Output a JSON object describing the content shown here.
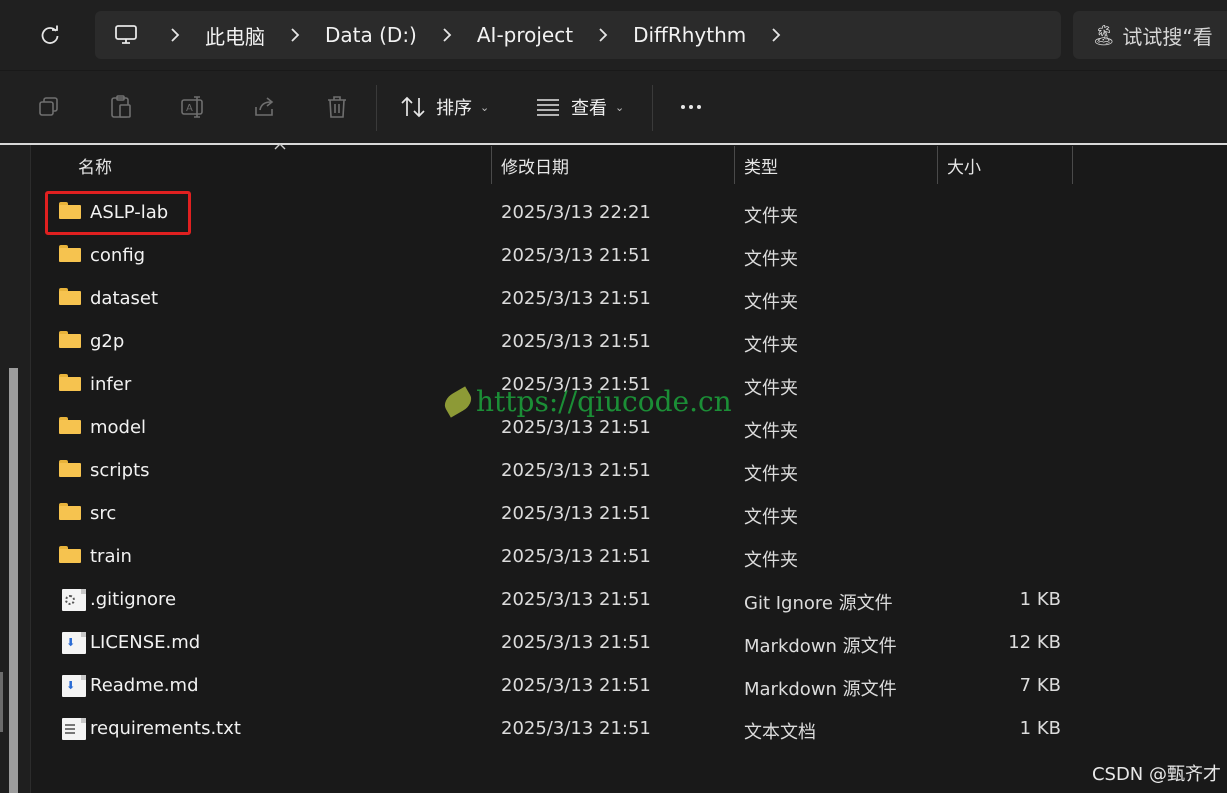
{
  "breadcrumb": {
    "items": [
      "此电脑",
      "Data (D:)",
      "AI-project",
      "DiffRhythm"
    ]
  },
  "search": {
    "placeholder": "试试搜“看"
  },
  "toolbar": {
    "sort_label": "排序",
    "view_label": "查看",
    "icons": [
      "copy-icon",
      "paste-icon",
      "rename-icon",
      "share-icon",
      "delete-icon"
    ]
  },
  "columns": {
    "name": "名称",
    "date": "修改日期",
    "type": "类型",
    "size": "大小"
  },
  "files": [
    {
      "name": "ASLP-lab",
      "date": "2025/3/13 22:21",
      "type": "文件夹",
      "size": "",
      "icon": "folder-icon"
    },
    {
      "name": "config",
      "date": "2025/3/13 21:51",
      "type": "文件夹",
      "size": "",
      "icon": "folder-icon"
    },
    {
      "name": "dataset",
      "date": "2025/3/13 21:51",
      "type": "文件夹",
      "size": "",
      "icon": "folder-icon"
    },
    {
      "name": "g2p",
      "date": "2025/3/13 21:51",
      "type": "文件夹",
      "size": "",
      "icon": "folder-icon"
    },
    {
      "name": "infer",
      "date": "2025/3/13 21:51",
      "type": "文件夹",
      "size": "",
      "icon": "folder-icon"
    },
    {
      "name": "model",
      "date": "2025/3/13 21:51",
      "type": "文件夹",
      "size": "",
      "icon": "folder-icon"
    },
    {
      "name": "scripts",
      "date": "2025/3/13 21:51",
      "type": "文件夹",
      "size": "",
      "icon": "folder-icon"
    },
    {
      "name": "src",
      "date": "2025/3/13 21:51",
      "type": "文件夹",
      "size": "",
      "icon": "folder-icon"
    },
    {
      "name": "train",
      "date": "2025/3/13 21:51",
      "type": "文件夹",
      "size": "",
      "icon": "folder-icon"
    },
    {
      "name": ".gitignore",
      "date": "2025/3/13 21:51",
      "type": "Git Ignore 源文件",
      "size": "1 KB",
      "icon": "config-file-icon"
    },
    {
      "name": "LICENSE.md",
      "date": "2025/3/13 21:51",
      "type": "Markdown 源文件",
      "size": "12 KB",
      "icon": "markdown-file-icon"
    },
    {
      "name": "Readme.md",
      "date": "2025/3/13 21:51",
      "type": "Markdown 源文件",
      "size": "7 KB",
      "icon": "markdown-file-icon"
    },
    {
      "name": "requirements.txt",
      "date": "2025/3/13 21:51",
      "type": "文本文档",
      "size": "1 KB",
      "icon": "text-file-icon"
    }
  ],
  "highlight_color": "#e02020",
  "watermark": "https://qiucode.cn",
  "credit": "CSDN @甄齐才"
}
